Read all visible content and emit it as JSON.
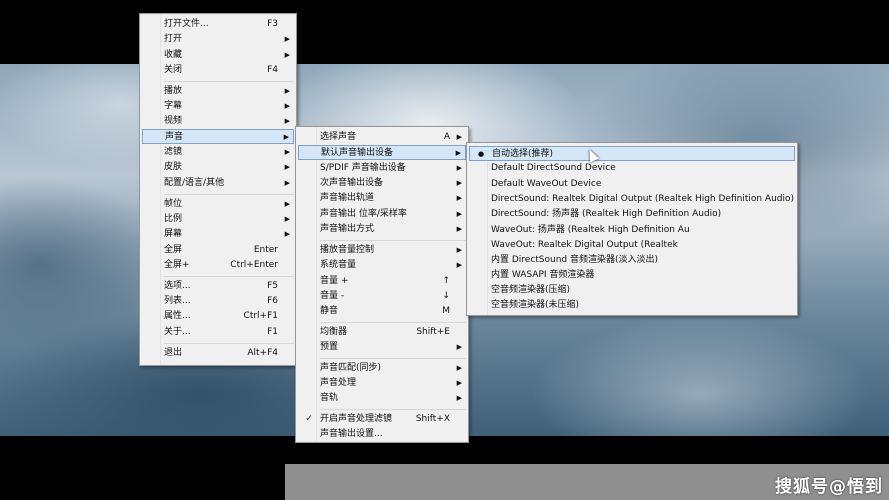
{
  "menu1": {
    "items": [
      {
        "label": "打开文件...",
        "shortcut": "F3",
        "arrow": ""
      },
      {
        "label": "打开",
        "shortcut": "",
        "arrow": "▶"
      },
      {
        "label": "收藏",
        "shortcut": "",
        "arrow": "▶"
      },
      {
        "label": "关闭",
        "shortcut": "F4",
        "arrow": ""
      },
      {
        "label": "播放",
        "shortcut": "",
        "arrow": "▶"
      },
      {
        "label": "字幕",
        "shortcut": "",
        "arrow": "▶"
      },
      {
        "label": "视频",
        "shortcut": "",
        "arrow": "▶"
      },
      {
        "label": "声音",
        "shortcut": "",
        "arrow": "▶"
      },
      {
        "label": "滤镜",
        "shortcut": "",
        "arrow": "▶"
      },
      {
        "label": "皮肤",
        "shortcut": "",
        "arrow": "▶"
      },
      {
        "label": "配置/语言/其他",
        "shortcut": "",
        "arrow": "▶"
      },
      {
        "label": "帧位",
        "shortcut": "",
        "arrow": "▶"
      },
      {
        "label": "比例",
        "shortcut": "",
        "arrow": "▶"
      },
      {
        "label": "屏幕",
        "shortcut": "",
        "arrow": "▶"
      },
      {
        "label": "全屏",
        "shortcut": "Enter",
        "arrow": ""
      },
      {
        "label": "全屏+",
        "shortcut": "Ctrl+Enter",
        "arrow": ""
      },
      {
        "label": "选项...",
        "shortcut": "F5",
        "arrow": ""
      },
      {
        "label": "列表...",
        "shortcut": "F6",
        "arrow": ""
      },
      {
        "label": "属性...",
        "shortcut": "Ctrl+F1",
        "arrow": ""
      },
      {
        "label": "关于...",
        "shortcut": "F1",
        "arrow": ""
      },
      {
        "label": "退出",
        "shortcut": "Alt+F4",
        "arrow": ""
      }
    ]
  },
  "menu2": {
    "items": [
      {
        "label": "选择声音",
        "shortcut": "A",
        "arrow": "▶",
        "mark": ""
      },
      {
        "label": "默认声音输出设备",
        "shortcut": "",
        "arrow": "▶",
        "mark": ""
      },
      {
        "label": "S/PDIF 声音输出设备",
        "shortcut": "",
        "arrow": "▶",
        "mark": ""
      },
      {
        "label": "次声音输出设备",
        "shortcut": "",
        "arrow": "▶",
        "mark": ""
      },
      {
        "label": "声音输出轨道",
        "shortcut": "",
        "arrow": "▶",
        "mark": ""
      },
      {
        "label": "声音输出 位率/采样率",
        "shortcut": "",
        "arrow": "▶",
        "mark": ""
      },
      {
        "label": "声音输出方式",
        "shortcut": "",
        "arrow": "▶",
        "mark": ""
      },
      {
        "label": "播放音量控制",
        "shortcut": "",
        "arrow": "▶",
        "mark": ""
      },
      {
        "label": "系统音量",
        "shortcut": "",
        "arrow": "▶",
        "mark": ""
      },
      {
        "label": "音量 +",
        "shortcut": "↑",
        "arrow": "",
        "mark": ""
      },
      {
        "label": "音量 -",
        "shortcut": "↓",
        "arrow": "",
        "mark": ""
      },
      {
        "label": "静音",
        "shortcut": "M",
        "arrow": "",
        "mark": ""
      },
      {
        "label": "均衡器",
        "shortcut": "Shift+E",
        "arrow": "",
        "mark": ""
      },
      {
        "label": "预置",
        "shortcut": "",
        "arrow": "▶",
        "mark": ""
      },
      {
        "label": "声音匹配(同步)",
        "shortcut": "",
        "arrow": "▶",
        "mark": ""
      },
      {
        "label": "声音处理",
        "shortcut": "",
        "arrow": "▶",
        "mark": ""
      },
      {
        "label": "音轨",
        "shortcut": "",
        "arrow": "▶",
        "mark": ""
      },
      {
        "label": "开启声音处理滤镜",
        "shortcut": "Shift+X",
        "arrow": "",
        "mark": "✓"
      },
      {
        "label": "声音输出设置...",
        "shortcut": "",
        "arrow": "",
        "mark": ""
      }
    ]
  },
  "menu3": {
    "items": [
      {
        "label": "自动选择(推荐)",
        "mark": "●"
      },
      {
        "label": "Default DirectSound Device",
        "mark": ""
      },
      {
        "label": "Default WaveOut Device",
        "mark": ""
      },
      {
        "label": "DirectSound: Realtek Digital Output (Realtek High Definition Audio)",
        "mark": ""
      },
      {
        "label": "DirectSound: 扬声器 (Realtek High Definition Audio)",
        "mark": ""
      },
      {
        "label": "WaveOut: 扬声器 (Realtek High Definition Au",
        "mark": ""
      },
      {
        "label": "WaveOut: Realtek Digital Output (Realtek",
        "mark": ""
      },
      {
        "label": "内置 DirectSound 音频渲染器(淡入淡出)",
        "mark": ""
      },
      {
        "label": "内置 WASAPI 音频渲染器",
        "mark": ""
      },
      {
        "label": "空音频渲染器(压缩)",
        "mark": ""
      },
      {
        "label": "空音频渲染器(未压缩)",
        "mark": ""
      }
    ]
  },
  "watermark": "搜狐号@悟到"
}
